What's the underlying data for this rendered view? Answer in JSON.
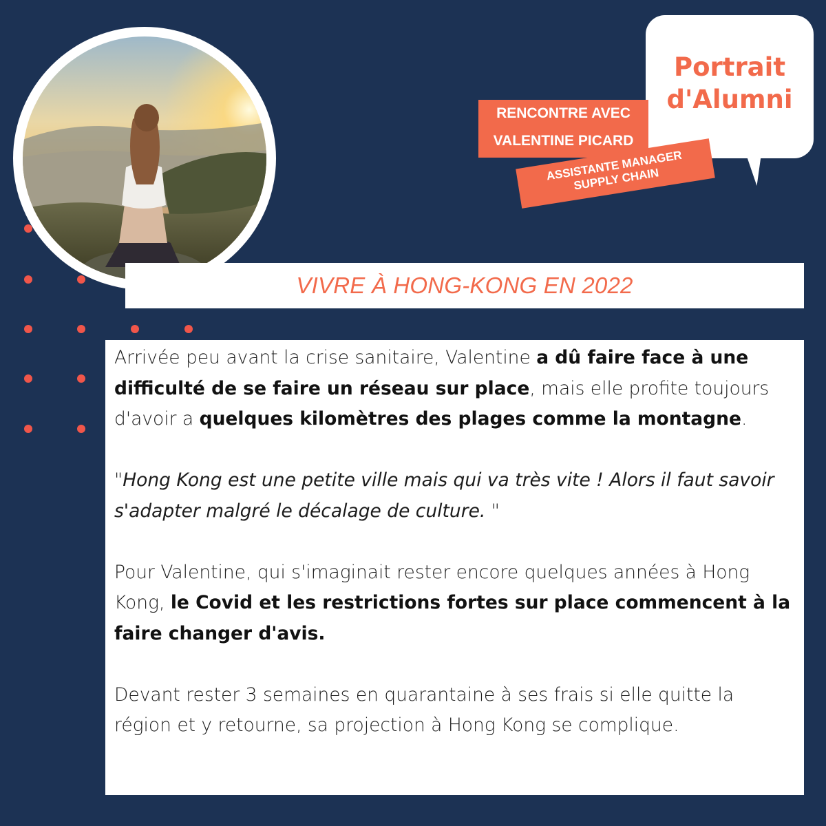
{
  "colors": {
    "background": "#1c3254",
    "accent": "#f26a4b",
    "dot": "#f0564a",
    "panel": "#ffffff"
  },
  "bubble": {
    "line1": "Portrait",
    "line2": "d'Alumni"
  },
  "tags": {
    "name_line1": "RENCONTRE AVEC",
    "name_line2": "VALENTINE PICARD",
    "role_line1": "ASSISTANTE MANAGER",
    "role_line2": "SUPPLY CHAIN"
  },
  "title": "VIVRE À HONG-KONG EN 2022",
  "article": {
    "p1_a": "Arrivée peu avant la crise sanitaire, Valentine ",
    "p1_b": "a dû faire face à une difficulté de se faire un réseau sur place",
    "p1_c": ", mais elle profite toujours d'avoir a ",
    "p1_d": "quelques kilomètres des plages comme la montagne",
    "p1_e": ".",
    "quote_open": "\"",
    "quote": "Hong Kong est une petite ville mais qui va très vite ! Alors il faut savoir s'adapter malgré le décalage de culture. ",
    "quote_close": "\"",
    "p3_a": "Pour Valentine, qui s'imaginait rester encore quelques années à Hong Kong, ",
    "p3_b": "le Covid et les restrictions fortes sur place commencent à la faire changer d'avis.",
    "p4": "Devant rester 3 semaines en quarantaine à ses frais si elle quitte la région et y retourne, sa projection à Hong Kong se complique."
  },
  "photo": {
    "icon": "woman-sunset-mountain-photo"
  }
}
